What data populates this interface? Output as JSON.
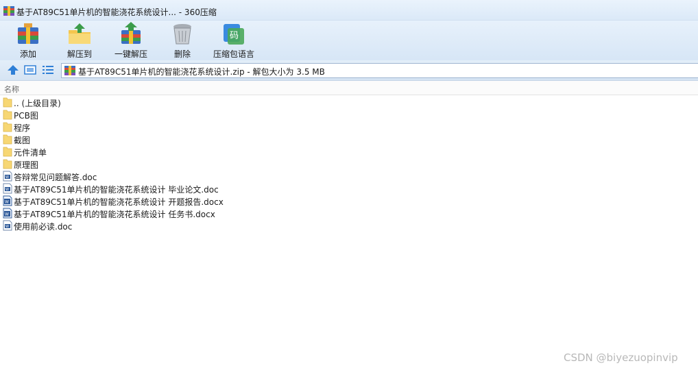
{
  "window": {
    "title": "基于AT89C51单片机的智能浇花系统设计... - 360压缩",
    "icon": "archive-icon"
  },
  "toolbar": {
    "items": [
      {
        "label": "添加",
        "icon": "add-archive-icon"
      },
      {
        "label": "解压到",
        "icon": "extract-to-icon"
      },
      {
        "label": "一键解压",
        "icon": "one-click-extract-icon"
      },
      {
        "label": "删除",
        "icon": "trash-icon"
      },
      {
        "label": "压缩包语言",
        "icon": "archive-language-icon"
      }
    ]
  },
  "addressbar": {
    "up_icon": "up-arrow-icon",
    "view_icon": "thumbnail-view-icon",
    "list_icon": "list-view-icon",
    "path": "基于AT89C51单片机的智能浇花系统设计.zip - 解包大小为 3.5 MB"
  },
  "filelist": {
    "column_header": "名称",
    "rows": [
      {
        "name": ".. (上级目录)",
        "type": "folder"
      },
      {
        "name": "PCB图",
        "type": "folder"
      },
      {
        "name": "程序",
        "type": "folder"
      },
      {
        "name": "截图",
        "type": "folder"
      },
      {
        "name": "元件清单",
        "type": "folder"
      },
      {
        "name": "原理图",
        "type": "folder"
      },
      {
        "name": "答辩常见问题解答.doc",
        "type": "doc"
      },
      {
        "name": "基于AT89C51单片机的智能浇花系统设计 毕业论文.doc",
        "type": "doc"
      },
      {
        "name": "基于AT89C51单片机的智能浇花系统设计 开题报告.docx",
        "type": "docx"
      },
      {
        "name": "基于AT89C51单片机的智能浇花系统设计 任务书.docx",
        "type": "docx"
      },
      {
        "name": "使用前必读.doc",
        "type": "doc"
      }
    ]
  },
  "watermark": "CSDN @biyezuopinvip",
  "colors": {
    "folder": "#f7d774",
    "accent_blue": "#2f7fd6",
    "doc_blue": "#2b5797"
  }
}
